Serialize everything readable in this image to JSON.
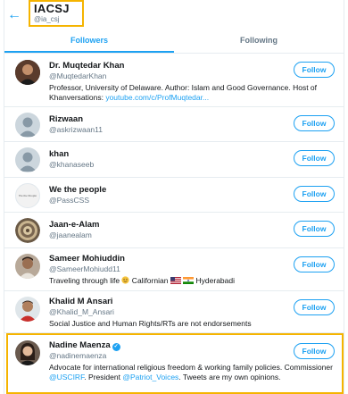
{
  "header": {
    "back_icon": "arrow-left-icon",
    "title": "IACSJ",
    "handle": "@ia_csj"
  },
  "tabs": [
    {
      "label": "Followers",
      "active": true
    },
    {
      "label": "Following",
      "active": false
    }
  ],
  "follow_label": "Follow",
  "colors": {
    "accent": "#1da1f2",
    "highlight": "#f5b400",
    "muted": "#657786"
  },
  "users": [
    {
      "name": "Dr. Muqtedar Khan",
      "username": "@MuqtedarKhan",
      "bio_text": "Professor, University of Delaware. Author: Islam and Good Governance. Host of Khanversations: ",
      "bio_link": "youtube.com/c/ProfMuqtedar...",
      "avatar": "photo-avatar"
    },
    {
      "name": "Rizwaan",
      "username": "@askrizwaan11",
      "avatar": "default-avatar"
    },
    {
      "name": "khan",
      "username": "@khanaseeb",
      "avatar": "default-avatar"
    },
    {
      "name": "We the people",
      "username": "@PassCSS",
      "avatar": "text-avatar",
      "avatar_text": "We the People"
    },
    {
      "name": "Jaan-e-Alam",
      "username": "@jaanealam",
      "avatar": "pattern-avatar"
    },
    {
      "name": "Sameer Mohiuddin",
      "username": "@SameerMohiudd11",
      "bio_a": "Traveling through life ",
      "bio_b": " Californian ",
      "bio_c": " Hyderabadi",
      "avatar": "photo-avatar"
    },
    {
      "name": "Khalid M Ansari",
      "username": "@Khalid_M_Ansari",
      "bio": "Social Justice and Human Rights/RTs are not endorsements",
      "avatar": "photo-avatar"
    },
    {
      "name": "Nadine Maenza",
      "username": "@nadinemaenza",
      "verified": true,
      "bio_a": "Advocate for international religious freedom & working family policies. Commissioner ",
      "bio_link1": "@USCIRF",
      "bio_b": ". President ",
      "bio_link2": "@Patriot_Voices",
      "bio_c": ". Tweets are my own opinions.",
      "avatar": "photo-avatar"
    }
  ]
}
